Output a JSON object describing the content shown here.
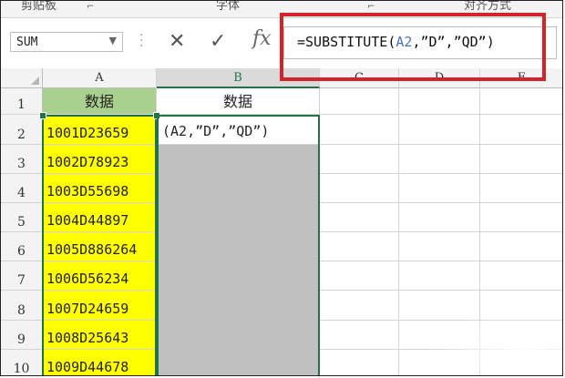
{
  "ribbon": {
    "groups": [
      "剪贴板",
      "字体",
      "对齐方式"
    ]
  },
  "formula_bar": {
    "name_box": "SUM",
    "cancel_icon": "✕",
    "enter_icon": "✓",
    "fx_label": "fx",
    "formula_prefix": "=SUBSTITUTE(",
    "formula_ref": "A2",
    "formula_suffix": ",”D”,”QD”)"
  },
  "columns": [
    "A",
    "B",
    "C",
    "D",
    "E"
  ],
  "rows": [
    "1",
    "2",
    "3",
    "4",
    "5",
    "6",
    "7",
    "8",
    "9",
    "10"
  ],
  "header_row": {
    "a": "数据",
    "b": "数据"
  },
  "column_a": [
    "1001D23659",
    "1002D78923",
    "1003D55698",
    "1004D44897",
    "1005D886264",
    "1006D56234",
    "1007D24659",
    "1008D25643",
    "1009D44678"
  ],
  "b2_edit": "(A2,”D”,”QD”)",
  "colors": {
    "header_fill": "#a9d08e",
    "data_fill": "#ffff00",
    "selection": "#217346",
    "callout": "#d3242a",
    "ref_blue": "#4472c4"
  }
}
